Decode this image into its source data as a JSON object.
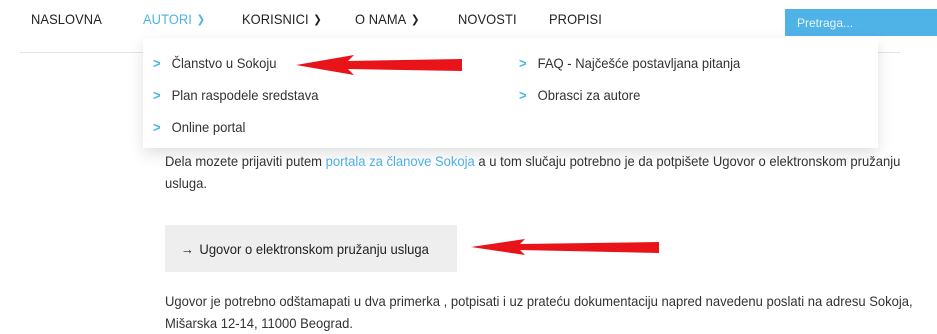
{
  "nav": {
    "items": [
      {
        "label": "NASLOVNA",
        "has_dropdown": false,
        "active": false
      },
      {
        "label": "AUTORI",
        "has_dropdown": true,
        "active": true
      },
      {
        "label": "KORISNICI",
        "has_dropdown": true,
        "active": false
      },
      {
        "label": "O NAMA",
        "has_dropdown": true,
        "active": false
      },
      {
        "label": "NOVOSTI",
        "has_dropdown": false,
        "active": false
      },
      {
        "label": "PROPISI",
        "has_dropdown": false,
        "active": false
      }
    ],
    "search_placeholder": "Pretraga...",
    "accent_color": "#4fb3e8"
  },
  "dropdown": {
    "left_items": [
      {
        "label": "Članstvo u Sokoju"
      },
      {
        "label": "Plan raspodele sredstava"
      },
      {
        "label": "Online portal"
      }
    ],
    "right_items": [
      {
        "label": "FAQ - Najčešće postavljana pitanja"
      },
      {
        "label": "Obrasci za autore"
      }
    ],
    "chevron_icon": "chevron-right-icon"
  },
  "content": {
    "para1_before": "Dela mozete prijaviti putem ",
    "para1_link": "portala za članove Sokoja",
    "para1_after": "  a u tom slučaju potrebno je da potpišete Ugovor o elektronskom pružanju usluga.",
    "button_arrow": "→",
    "button_label": "Ugovor o elektronskom pružanju usluga",
    "para2": "Ugovor je potrebno odštamapati  u dva primerka , potpisati i uz prateću dokumentaciju napred navedenu poslati na adresu Sokoja, Mišarska 12-14, 11000 Beograd."
  },
  "annotations": {
    "arrow_color": "#e8141a"
  }
}
